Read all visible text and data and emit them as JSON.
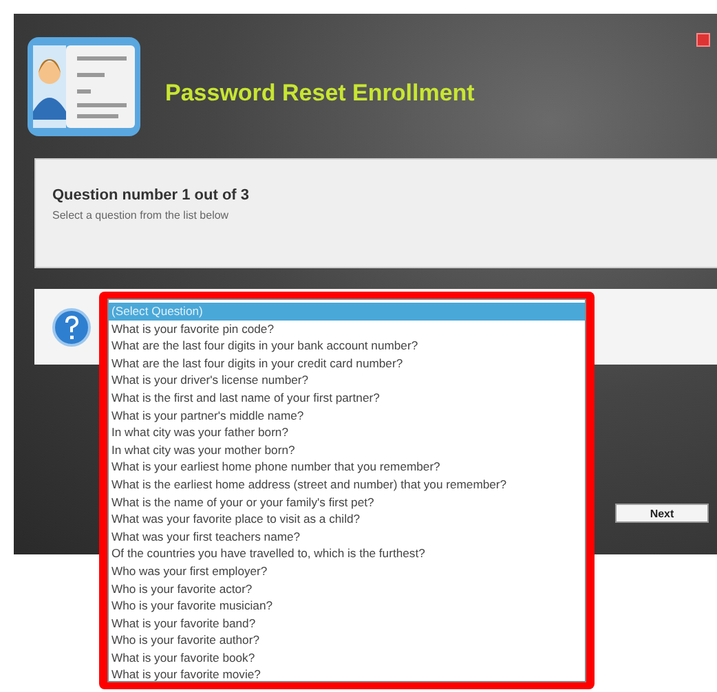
{
  "window": {
    "title": "Password Reset Enrollment"
  },
  "question": {
    "heading": "Question number 1 out of 3",
    "instruction": "Select a question from the list below"
  },
  "dropdown": {
    "highlighted": true,
    "options": [
      {
        "label": "(Select Question)",
        "selected": true
      },
      {
        "label": "What is your favorite pin code?",
        "selected": false
      },
      {
        "label": "What are the last four digits in your bank account number?",
        "selected": false
      },
      {
        "label": "What are the last four digits in your credit card number?",
        "selected": false
      },
      {
        "label": "What is your driver's license number?",
        "selected": false
      },
      {
        "label": "What is the first and last name of your first partner?",
        "selected": false
      },
      {
        "label": "What is your partner's middle name?",
        "selected": false
      },
      {
        "label": "In what city was your father born?",
        "selected": false
      },
      {
        "label": "In what city was your mother born?",
        "selected": false
      },
      {
        "label": "What is your earliest home phone number that you remember?",
        "selected": false
      },
      {
        "label": "What is the earliest home address (street and number) that you remember?",
        "selected": false
      },
      {
        "label": "What is the name of your or your family's first pet?",
        "selected": false
      },
      {
        "label": "What was your favorite place to visit as a child?",
        "selected": false
      },
      {
        "label": "What was your first teachers name?",
        "selected": false
      },
      {
        "label": "Of the countries you have travelled to, which is the furthest?",
        "selected": false
      },
      {
        "label": "Who was your first employer?",
        "selected": false
      },
      {
        "label": "Who is your favorite actor?",
        "selected": false
      },
      {
        "label": "Who is your favorite musician?",
        "selected": false
      },
      {
        "label": "What is your favorite band?",
        "selected": false
      },
      {
        "label": "Who is your favorite author?",
        "selected": false
      },
      {
        "label": "What is your favorite book?",
        "selected": false
      },
      {
        "label": "What is your favorite movie?",
        "selected": false
      }
    ]
  },
  "buttons": [
    {
      "label": "Next"
    }
  ]
}
